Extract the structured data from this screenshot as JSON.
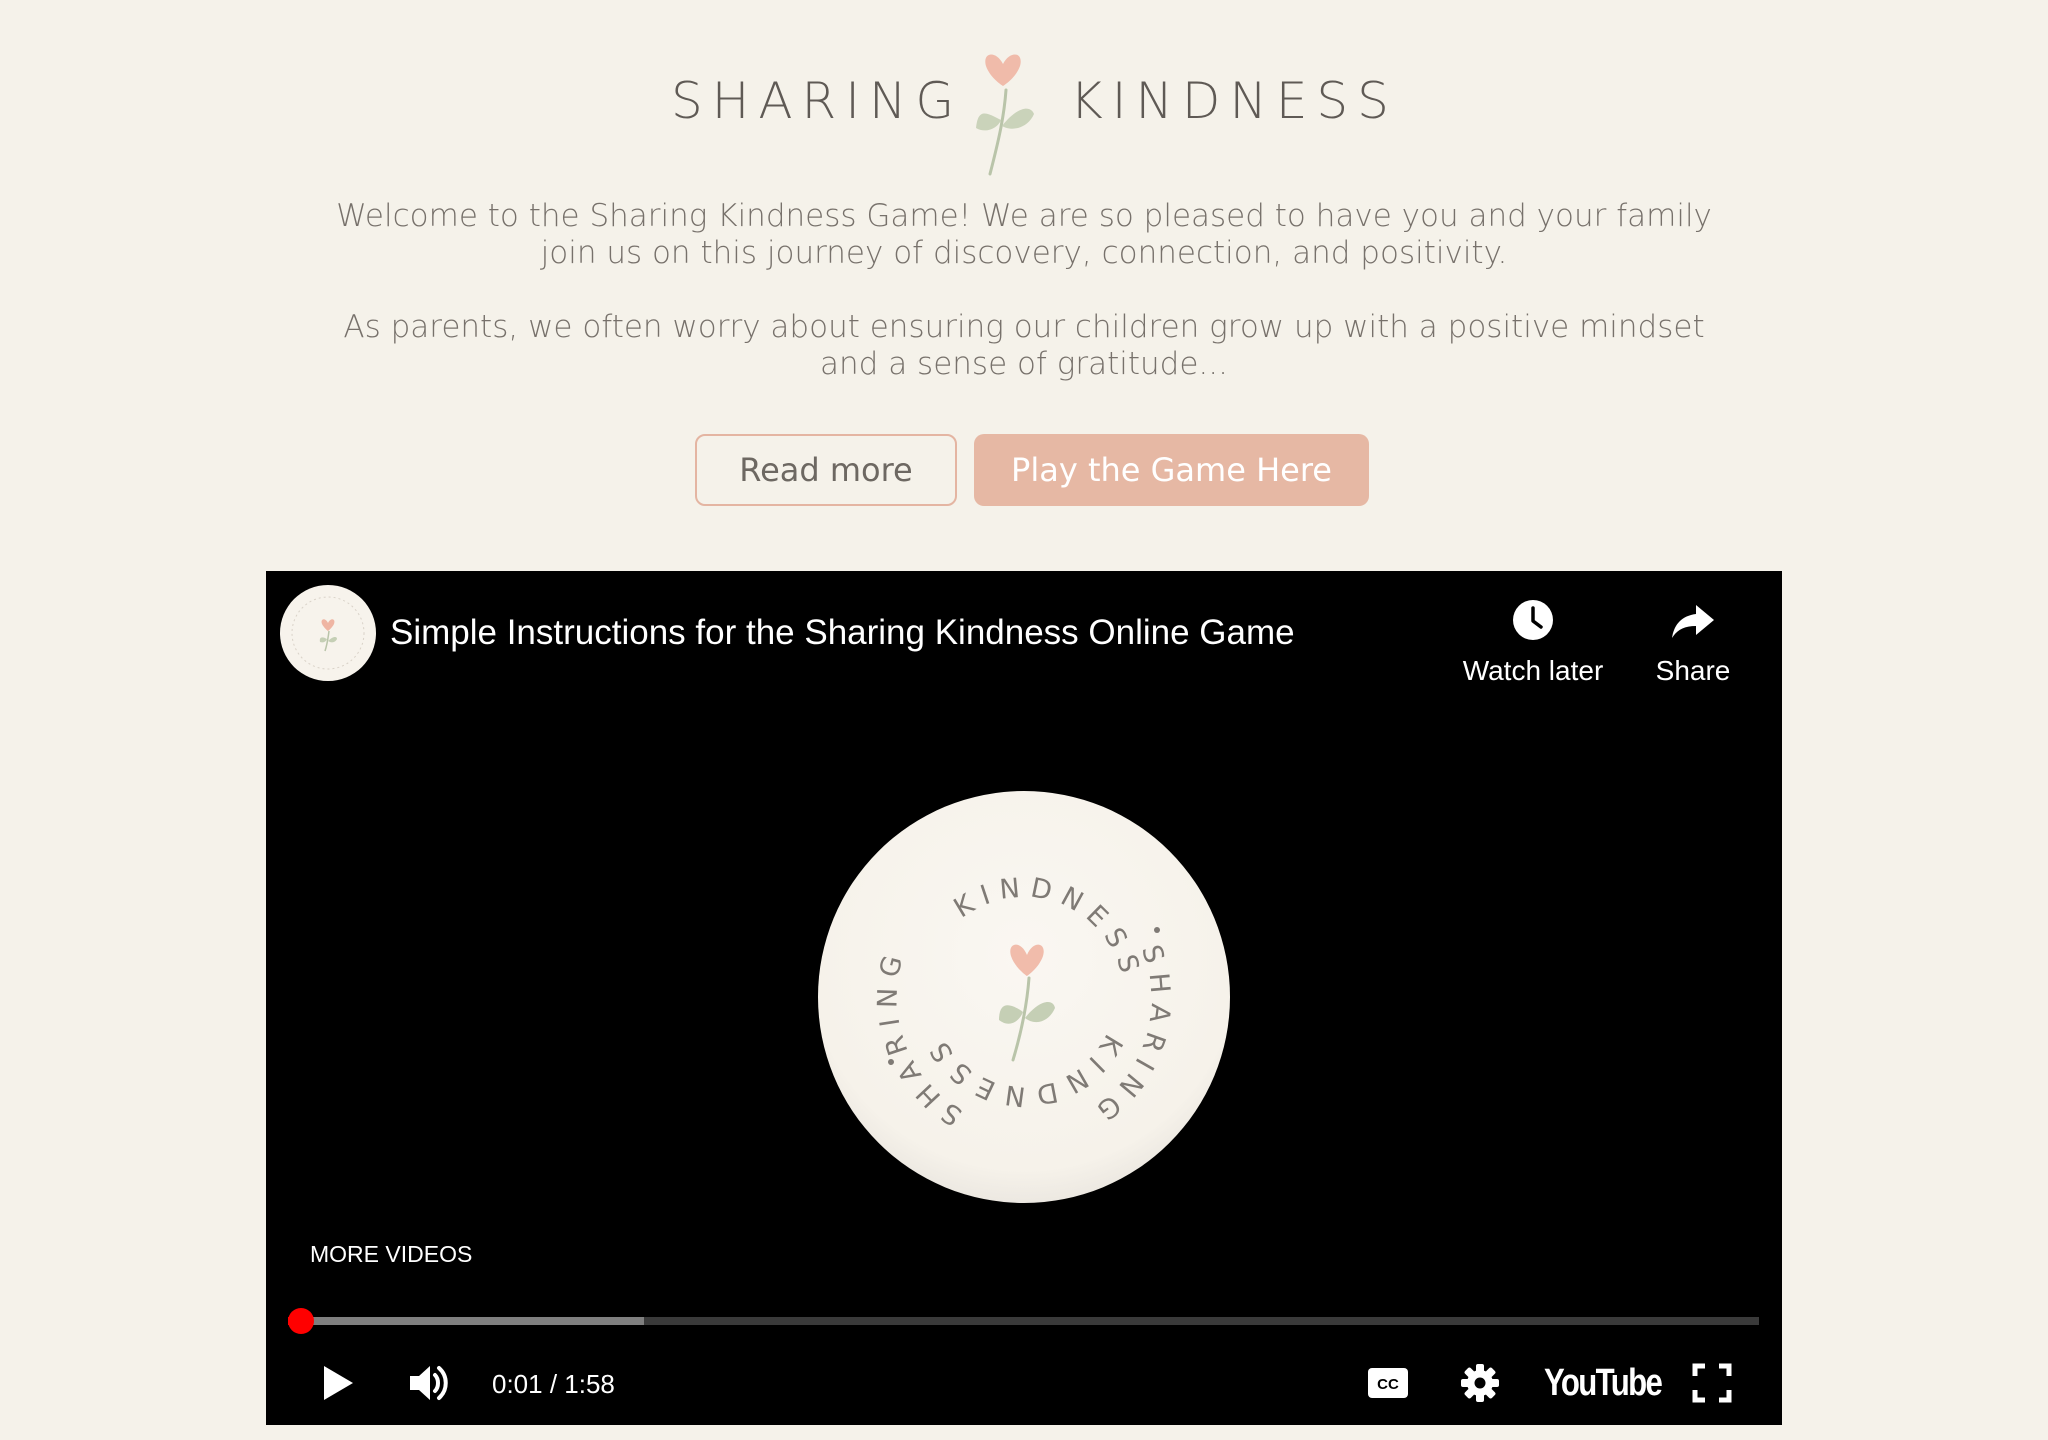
{
  "header": {
    "logo_left": "SHARING",
    "logo_right": "KINDNESS"
  },
  "intro": {
    "paragraph1": "Welcome to the Sharing Kindness Game! We are so pleased to have you and your family join us on this journey of discovery, connection, and positivity.",
    "paragraph2": "As parents, we often worry about ensuring our children grow up with a positive mindset and a sense of gratitude..."
  },
  "buttons": {
    "read_more": "Read more",
    "play_game": "Play the Game Here"
  },
  "video": {
    "title": "Simple Instructions for the Sharing Kindness Online Game",
    "watch_later_label": "Watch later",
    "share_label": "Share",
    "more_videos_label": "MORE VIDEOS",
    "time_current": "0:01",
    "time_separator": "/",
    "time_total": "1:58",
    "time_display": "0:01 / 1:58",
    "played_fraction": 0.0085,
    "buffered_fraction": 0.242,
    "youtube_logo": "YouTube",
    "center_logo_top_text": "KINDNESS",
    "center_logo_left_text": "SHARING",
    "center_logo_right_text": "SHARING",
    "center_logo_bottom_text": "KINDNESS",
    "icons": {
      "watch_later": "clock-icon",
      "share": "share-arrow-icon",
      "play": "play-icon",
      "volume": "volume-icon",
      "captions": "cc-icon",
      "settings": "gear-icon",
      "fullscreen": "fullscreen-icon"
    }
  },
  "colors": {
    "page_background": "#f5f2ea",
    "accent": "#e6b8a4",
    "text": "#77716b",
    "progress_played": "#ff0000"
  }
}
